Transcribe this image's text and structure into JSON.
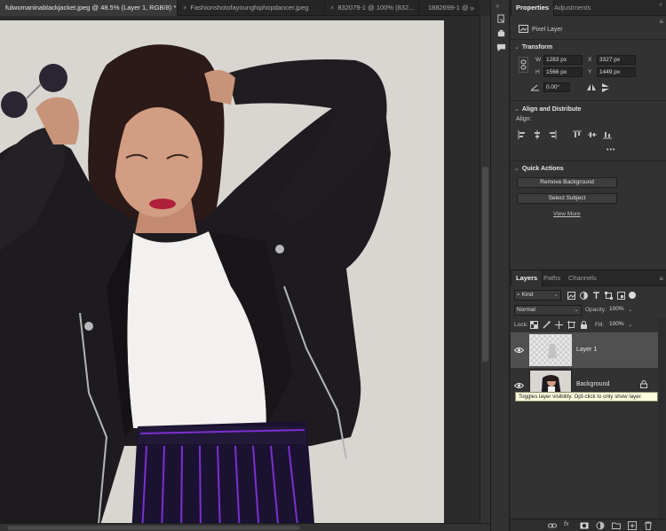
{
  "tabs": [
    {
      "label": "fulwomaninablackjacket.jpeg @ 48.5% (Layer 1, RGB/8) *",
      "close": "×",
      "active": true
    },
    {
      "label": "Fashionshotofayounghiphopdancer.jpeg",
      "close": "×",
      "active": false
    },
    {
      "label": "832079-1 @ 100% (832...",
      "close": "×",
      "active": false
    },
    {
      "label": "1882699-1 @",
      "close": "",
      "active": false
    }
  ],
  "tab_overflow": "»",
  "properties": {
    "tabs": [
      "Properties",
      "Adjustments"
    ],
    "kind_label": "Pixel Layer",
    "transform": {
      "title": "Transform",
      "w_label": "W",
      "w_value": "1283 px",
      "x_label": "X",
      "x_value": "3327 px",
      "h_label": "H",
      "h_value": "1566 px",
      "y_label": "Y",
      "y_value": "1449 px",
      "angle_value": "0.00°"
    },
    "align": {
      "title": "Align and Distribute",
      "align_label": "Align:",
      "more": "•••"
    },
    "quick_actions": {
      "title": "Quick Actions",
      "remove_bg": "Remove Background",
      "select_subject": "Select Subject",
      "view_more": "View More"
    }
  },
  "layers_panel": {
    "tabs": [
      "Layers",
      "Paths",
      "Channels"
    ],
    "filter_kind": "Kind",
    "blend_mode": "Normal",
    "opacity_label": "Opacity:",
    "opacity_value": "100%",
    "lock_label": "Lock:",
    "fill_label": "Fill:",
    "fill_value": "100%",
    "layers": [
      {
        "name": "Layer 1",
        "selected": true,
        "visible": true
      },
      {
        "name": "Background",
        "selected": false,
        "visible": true,
        "locked": true
      }
    ],
    "tooltip": "Toggles layer visibility. Opt-click to only show layer."
  },
  "colors": {
    "app_bg": "#2b2b2b",
    "panel_bg": "#323232",
    "selected_row": "#505050",
    "backdrop": "#d9d6d1",
    "jacket": "#1c1a1d",
    "skirt_stripe": "#7b2fd0"
  }
}
